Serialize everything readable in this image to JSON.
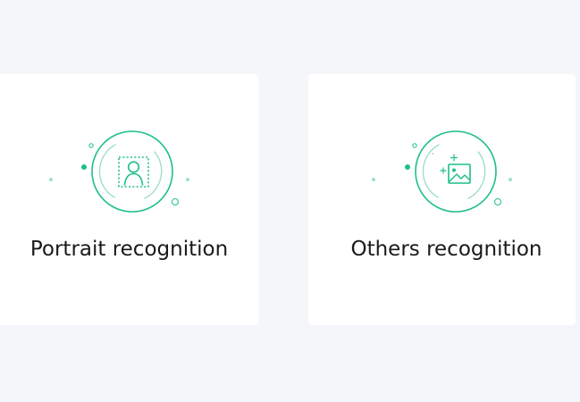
{
  "cards": [
    {
      "label": "Portrait recognition",
      "icon": "portrait-recognition-icon"
    },
    {
      "label": "Others recognition",
      "icon": "image-recognition-icon"
    }
  ],
  "colors": {
    "background": "#f5f6f9",
    "card": "#ffffff",
    "accent": "#1dbf8a",
    "accent_light": "#9edfc7",
    "text": "#1a1a1a"
  }
}
